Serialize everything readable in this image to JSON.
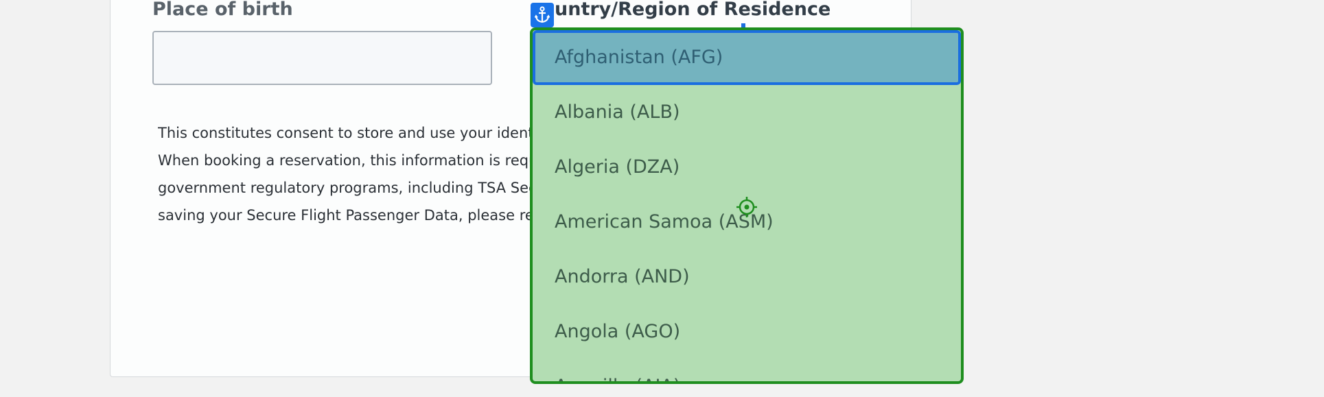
{
  "form": {
    "place_of_birth_label": "Place of birth",
    "place_of_birth_value": "",
    "residence_label_visible": "untry/Region of Residence",
    "consent_lines": [
      "This constitutes consent to store and use your identifi",
      "When booking a reservation, this information is requ",
      "government regulatory programs, including TSA Sec",
      "saving your Secure Flight Passenger Data, please ren"
    ]
  },
  "dropdown": {
    "options": [
      "Afghanistan (AFG)",
      "Albania (ALB)",
      "Algeria (DZA)",
      "American Samoa (ASM)",
      "Andorra (AND)",
      "Angola (AGO)",
      "Anguilla (AIA)"
    ],
    "selected_option": "Afghanistan (AFG)"
  },
  "icons": {
    "anchor": "anchor-icon",
    "focus": "crosshair-target-icon"
  },
  "colors": {
    "listbox_background": "#b3ddb3",
    "listbox_border": "#1f8e1f",
    "selected_background": "#74b3bf",
    "selected_border": "#1a6ee0",
    "anchor_badge": "#1a73e8"
  }
}
